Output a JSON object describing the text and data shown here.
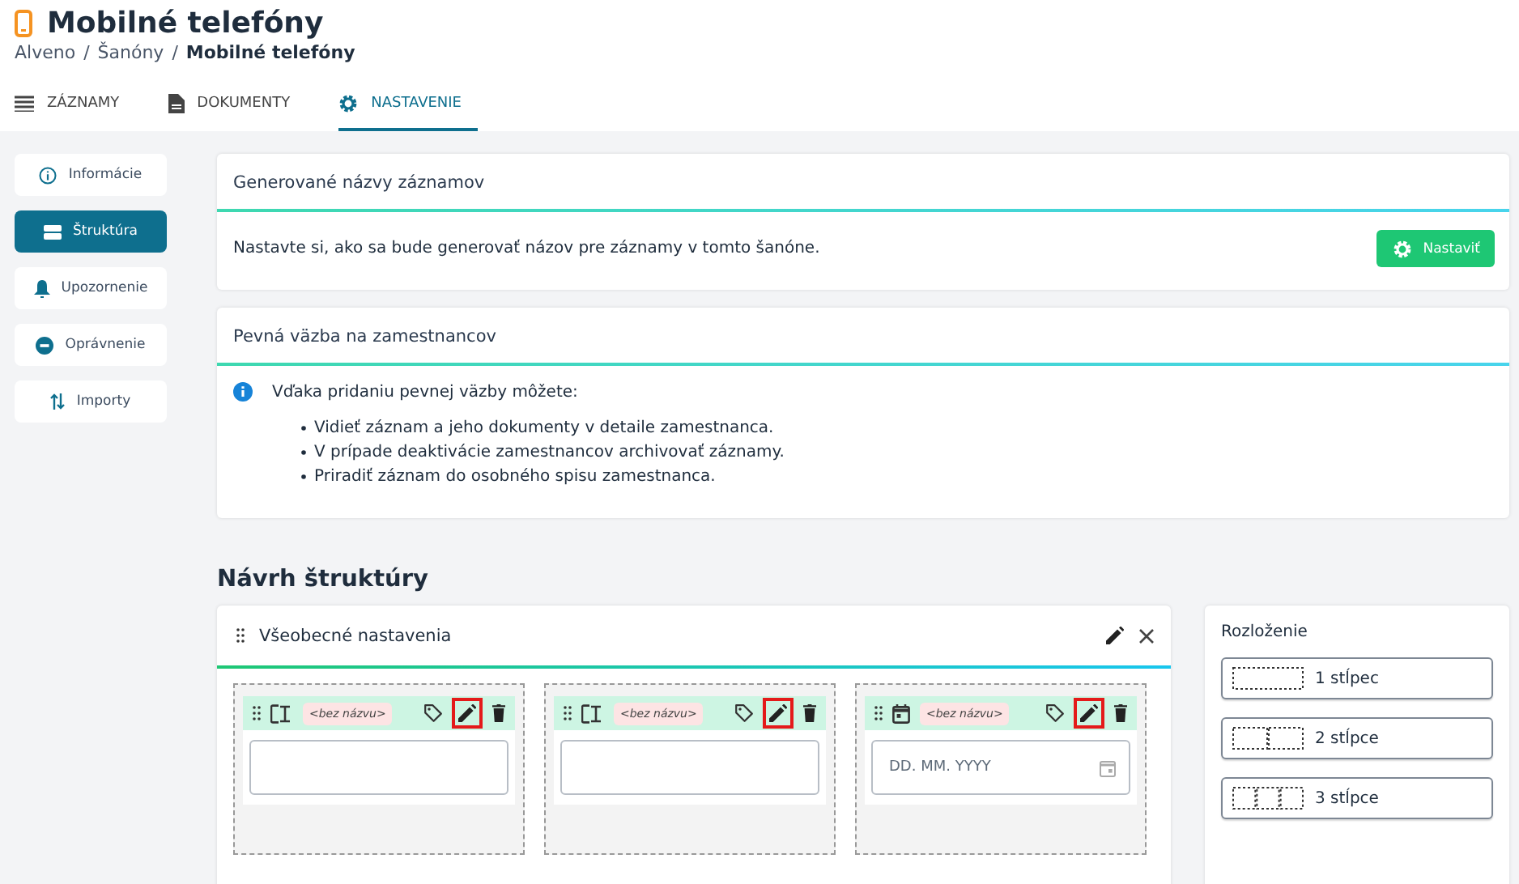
{
  "header": {
    "title": "Mobilné telefóny",
    "separator": "/",
    "breadcrumb": [
      {
        "label": "Alveno",
        "current": false
      },
      {
        "label": "Šanóny",
        "current": false
      },
      {
        "label": "Mobilné telefóny",
        "current": true
      }
    ]
  },
  "tabs": [
    {
      "label": "ZÁZNAMY",
      "selected": false
    },
    {
      "label": "DOKUMENTY",
      "selected": false
    },
    {
      "label": "NASTAVENIE",
      "selected": true
    }
  ],
  "sidebar": {
    "items": [
      {
        "label": "Informácie",
        "selected": false
      },
      {
        "label": "Štruktúra",
        "selected": true
      },
      {
        "label": "Upozornenie",
        "selected": false
      },
      {
        "label": "Oprávnenie",
        "selected": false
      },
      {
        "label": "Importy",
        "selected": false
      }
    ]
  },
  "generated_names": {
    "title": "Generované názvy záznamov",
    "text": "Nastavte si, ako sa bude generovať názov pre záznamy v tomto šanóne.",
    "button": "Nastaviť"
  },
  "employee_link": {
    "title": "Pevná väzba na zamestnancov",
    "intro": "Vďaka pridaniu pevnej väzby môžete:",
    "points": [
      "Vidieť záznam a jeho dokumenty v detaile zamestnanca.",
      "V prípade deaktivácie zamestnancov archivovať záznamy.",
      "Priradiť záznam do osobného spisu zamestnanca."
    ]
  },
  "structure": {
    "heading": "Návrh štruktúry",
    "section_title": "Všeobecné nastavenia",
    "fields": [
      {
        "kind": "text",
        "name": "<bez názvu>",
        "edit_highlighted": true
      },
      {
        "kind": "text",
        "name": "<bez názvu>",
        "edit_highlighted": true
      },
      {
        "kind": "date",
        "name": "<bez názvu>",
        "placeholder": "DD. MM. YYYY",
        "edit_highlighted": true
      }
    ]
  },
  "layout": {
    "title": "Rozloženie",
    "options": [
      {
        "label": "1 stĺpec"
      },
      {
        "label": "2 stĺpce"
      },
      {
        "label": "3 stĺpce"
      }
    ]
  }
}
